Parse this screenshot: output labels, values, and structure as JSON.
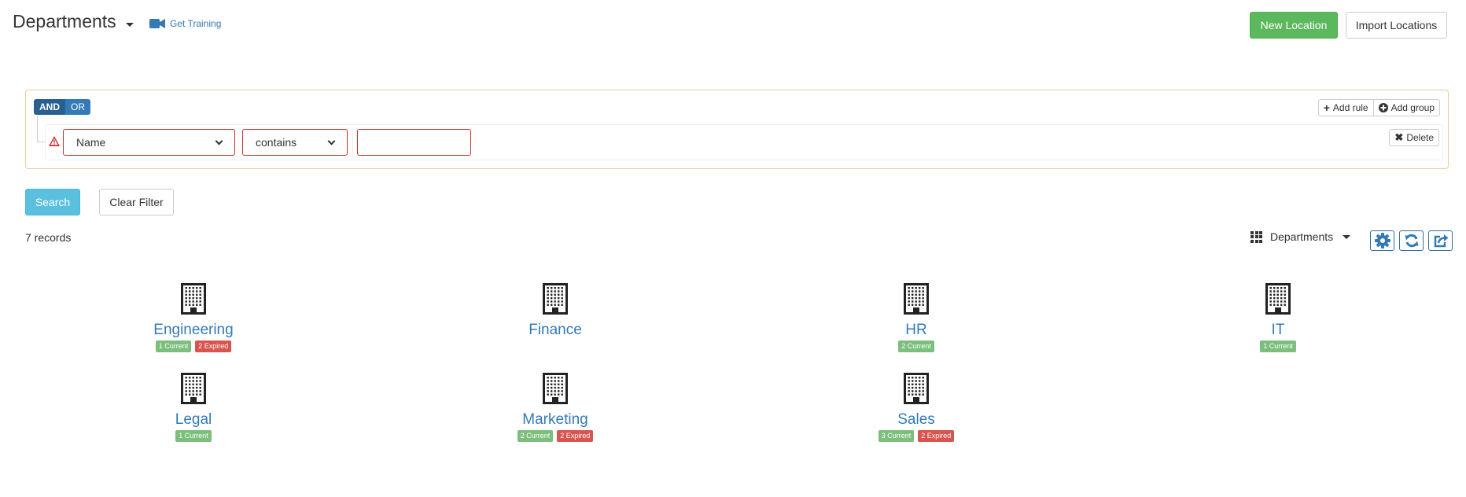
{
  "header": {
    "title": "Departments",
    "training_label": "Get Training",
    "new_location_label": "New Location",
    "import_locations_label": "Import Locations"
  },
  "query_builder": {
    "and_label": "AND",
    "or_label": "OR",
    "add_rule_label": "Add rule",
    "add_group_label": "Add group",
    "delete_label": "Delete",
    "field_value": "Name",
    "operator_value": "contains",
    "text_value": ""
  },
  "actions": {
    "search_label": "Search",
    "clear_filter_label": "Clear Filter"
  },
  "toolbar": {
    "records_label": "7 records",
    "view_label": "Departments"
  },
  "departments": [
    {
      "name": "Engineering",
      "current": "1 Current",
      "expired": "2 Expired"
    },
    {
      "name": "Finance",
      "current": "",
      "expired": ""
    },
    {
      "name": "HR",
      "current": "2 Current",
      "expired": ""
    },
    {
      "name": "IT",
      "current": "1 Current",
      "expired": ""
    },
    {
      "name": "Legal",
      "current": "1 Current",
      "expired": ""
    },
    {
      "name": "Marketing",
      "current": "2 Current",
      "expired": "2 Expired"
    },
    {
      "name": "Sales",
      "current": "3 Current",
      "expired": "2 Expired"
    }
  ],
  "colors": {
    "primary": "#337ab7",
    "success": "#5cb85c",
    "info": "#5bc0de",
    "danger": "#d9534f",
    "filter_border": "#f0c99a"
  },
  "icons": [
    "video-camera-icon",
    "caret-down-icon",
    "plus-icon",
    "plus-circle-icon",
    "times-icon",
    "warning-icon",
    "grid-icon",
    "gear-icon",
    "refresh-icon",
    "share-icon",
    "building-icon"
  ]
}
